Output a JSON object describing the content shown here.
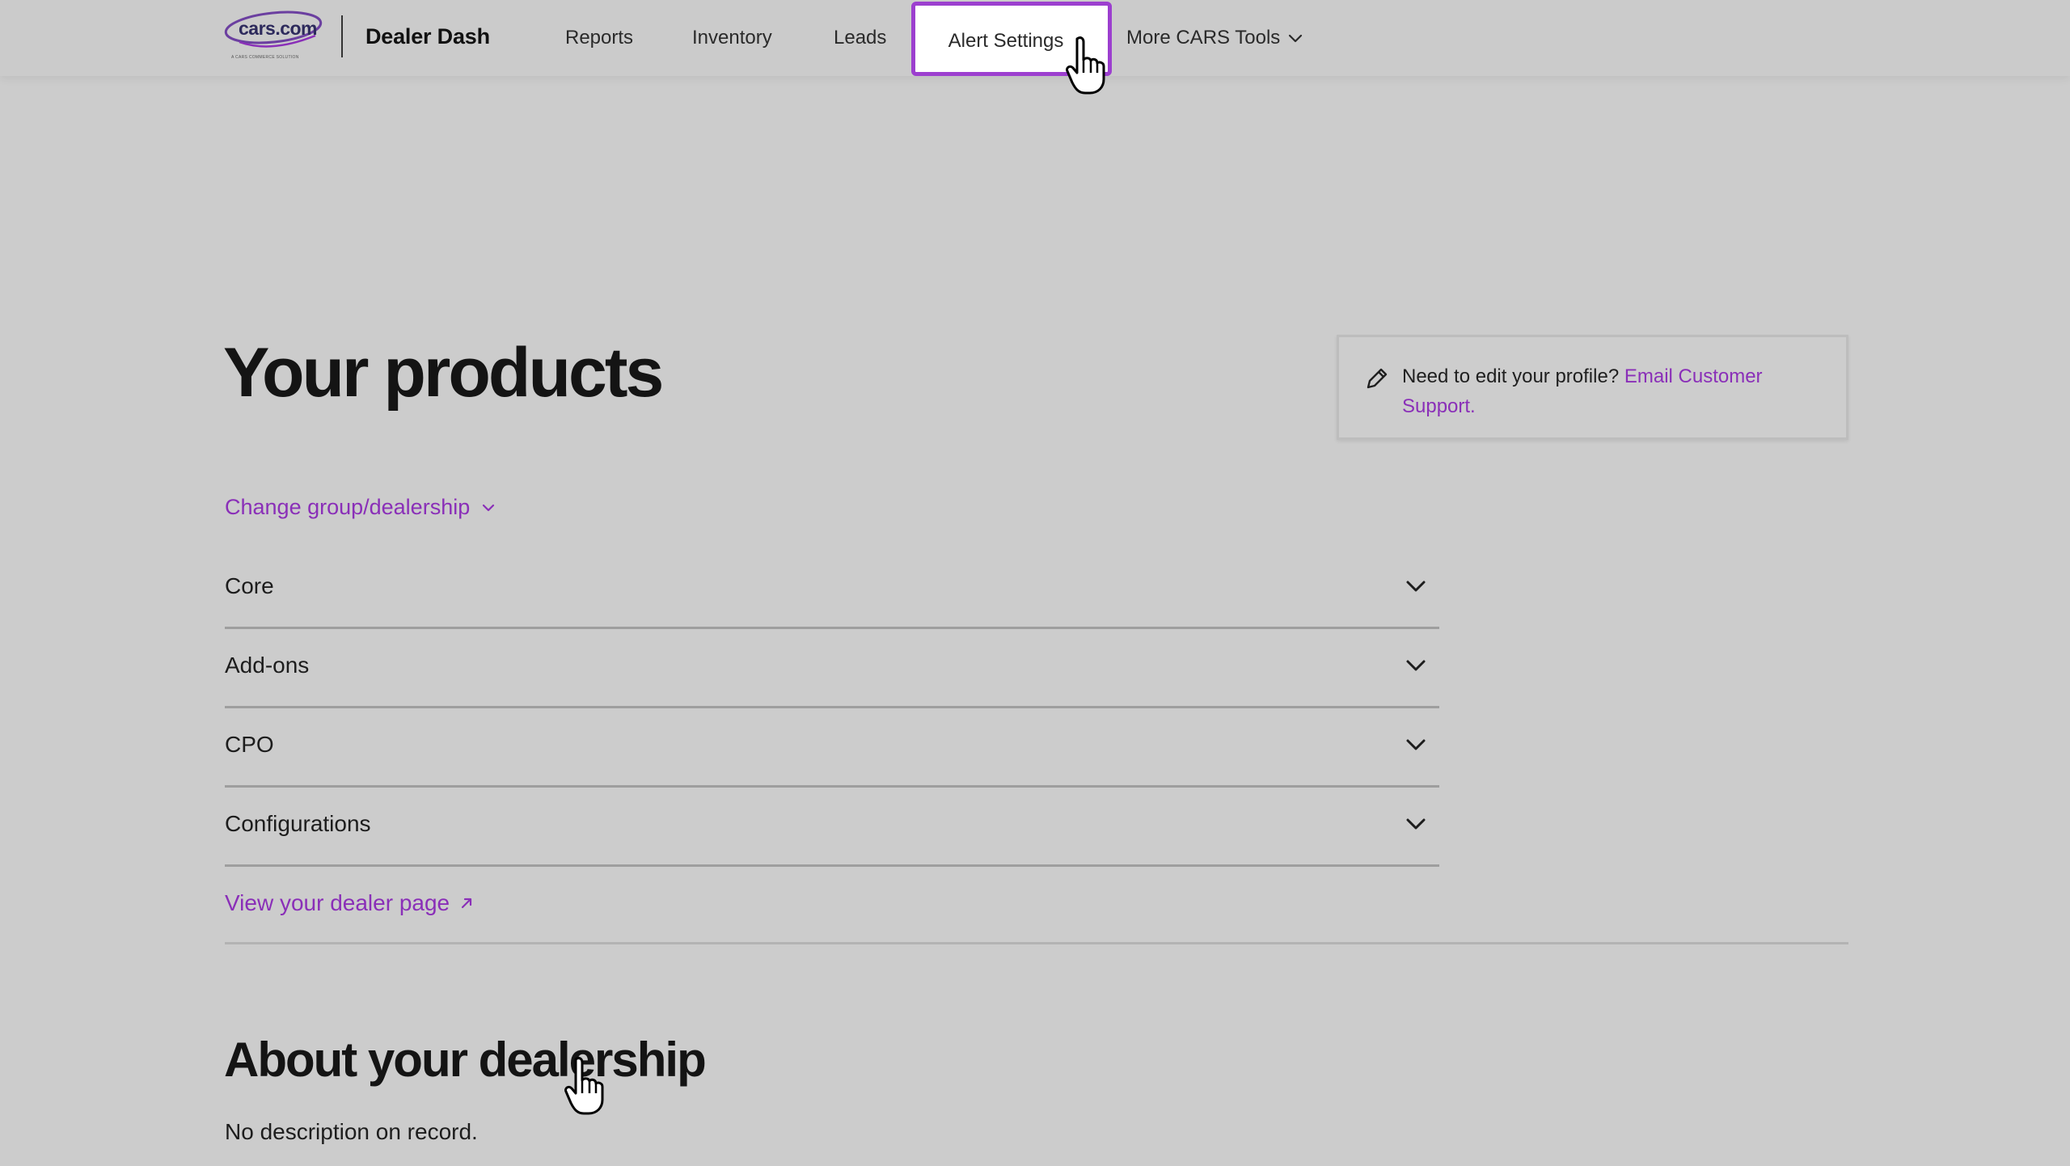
{
  "brand": {
    "logo_text": "cars.com",
    "logo_tagline": "A CARS COMMERCE SOLUTION",
    "product_name": "Dealer Dash"
  },
  "nav": {
    "items": [
      {
        "label": "Reports"
      },
      {
        "label": "Inventory"
      },
      {
        "label": "Leads"
      },
      {
        "label": "Alert Settings"
      },
      {
        "label": "More CARS Tools"
      }
    ]
  },
  "main": {
    "title": "Your products",
    "profile_card": {
      "text": "Need to edit your profile?",
      "link_label": "Email Customer Support."
    },
    "change_group_label": "Change group/dealership",
    "accordion": [
      {
        "label": "Core"
      },
      {
        "label": "Add-ons"
      },
      {
        "label": "CPO"
      },
      {
        "label": "Configurations"
      }
    ],
    "dealer_page_link": "View your dealer page",
    "about": {
      "title": "About your dealership",
      "description": "No description on record."
    }
  },
  "colors": {
    "background": "#cccccc",
    "accent_purple": "#8a2fb8",
    "highlight_border": "#9c3fcf",
    "text": "#1a1a1a"
  },
  "icons": {
    "pencil": "pencil-icon",
    "chevron": "chevron-down-icon",
    "external": "external-link-arrow-icon",
    "cursor": "hand-pointer-cursor-icon"
  }
}
